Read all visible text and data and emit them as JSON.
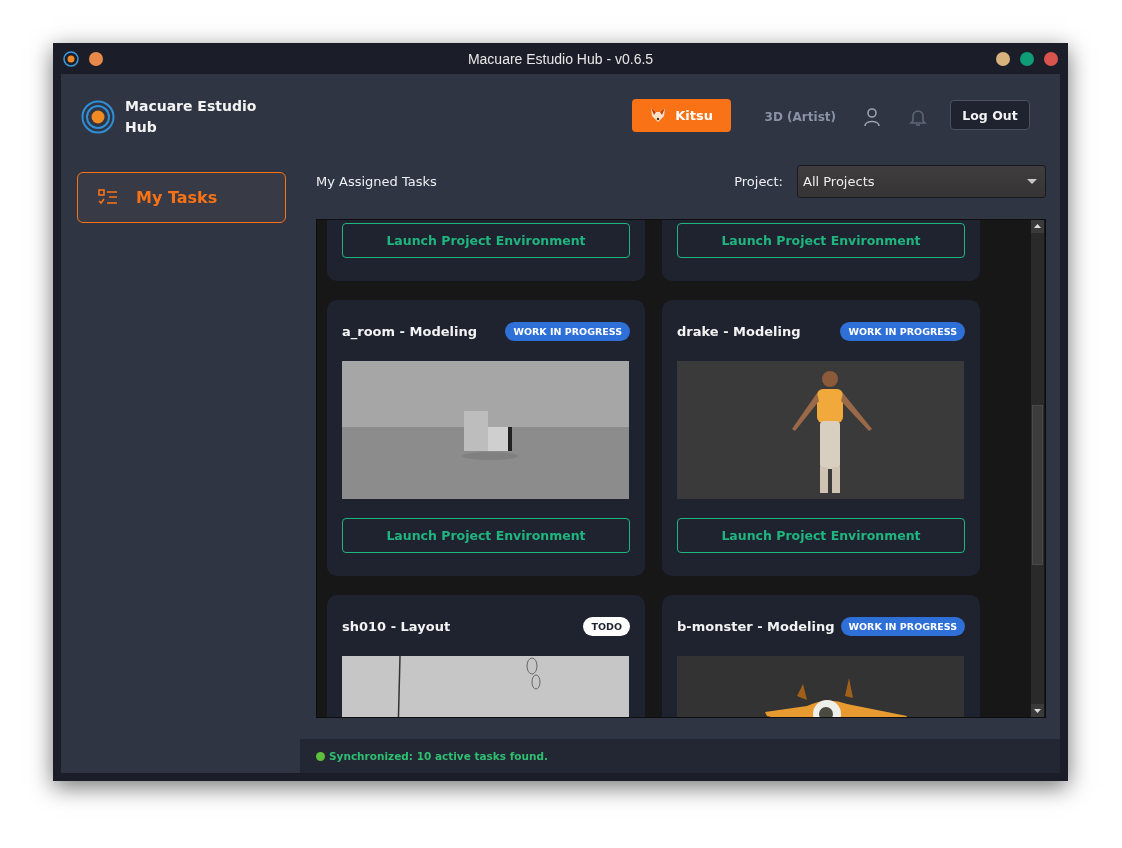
{
  "window": {
    "title": "Macuare Estudio Hub - v0.6.5"
  },
  "header": {
    "app_name": "Macuare Estudio Hub",
    "service_button": "Kitsu",
    "role": "3D (Artist)",
    "logout_button": "Log Out"
  },
  "sidebar": {
    "items": [
      {
        "label": "My Tasks",
        "selected": true
      }
    ]
  },
  "toolbar": {
    "title": "My Assigned Tasks",
    "project_label": "Project:",
    "project_select": "All Projects"
  },
  "tasks": [
    {
      "kind": "partial",
      "button": "Launch Project Environment"
    },
    {
      "kind": "partial",
      "button": "Launch Project Environment"
    },
    {
      "kind": "full",
      "title": "a_room - Modeling",
      "status": "WORK IN PROGRESS",
      "color": "#2f6fd8",
      "button": "Launch Project Environment"
    },
    {
      "kind": "full",
      "title": "drake - Modeling",
      "status": "WORK IN PROGRESS",
      "color": "#2f6fd8",
      "button": "Launch Project Environment"
    },
    {
      "kind": "cut",
      "title": "sh010 - Layout",
      "status": "TODO",
      "color": "#ffffff"
    },
    {
      "kind": "cut",
      "title": "b-monster - Modeling",
      "status": "WORK IN PROGRESS",
      "color": "#2f6fd8"
    }
  ],
  "status_bar": {
    "message": "Synchronized: 10 active tasks found."
  }
}
